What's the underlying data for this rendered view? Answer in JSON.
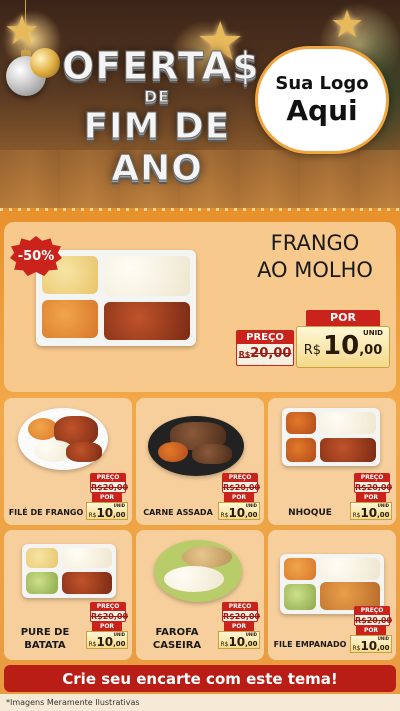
{
  "header": {
    "title_line1": "OFERTA$",
    "title_line2": "DE",
    "title_line3": "FIM DE ANO",
    "logo_line1": "Sua Logo",
    "logo_line2": "Aqui"
  },
  "featured": {
    "badge": "-50%",
    "name_line1": "FRANGO",
    "name_line2": "AO MOLHO",
    "preco_label": "PREÇO",
    "old_currency": "R$",
    "old_price": "20,00",
    "por_label": "POR",
    "currency": "R$",
    "price_int": "10",
    "price_dec": ",00",
    "unit": "UNID"
  },
  "products": [
    {
      "name_line1": "FILÉ DE FRANGO",
      "name_line2": "",
      "preco_label": "PREÇO",
      "old_price": "R$20,00",
      "por_label": "POR",
      "currency": "R$",
      "price_int": "10",
      "price_dec": ",00",
      "unit": "UNID"
    },
    {
      "name_line1": "CARNE ASSADA",
      "name_line2": "",
      "preco_label": "PREÇO",
      "old_price": "R$20,00",
      "por_label": "POR",
      "currency": "R$",
      "price_int": "10",
      "price_dec": ",00",
      "unit": "UNID"
    },
    {
      "name_line1": "NHOQUE",
      "name_line2": "",
      "preco_label": "PREÇO",
      "old_price": "R$20,00",
      "por_label": "POR",
      "currency": "R$",
      "price_int": "10",
      "price_dec": ",00",
      "unit": "UNID"
    },
    {
      "name_line1": "PURE DE",
      "name_line2": "BATATA",
      "preco_label": "PREÇO",
      "old_price": "R$20,00",
      "por_label": "POR",
      "currency": "R$",
      "price_int": "10",
      "price_dec": ",00",
      "unit": "UNID"
    },
    {
      "name_line1": "FAROFA",
      "name_line2": "CASEIRA",
      "preco_label": "PREÇO",
      "old_price": "R$20,00",
      "por_label": "POR",
      "currency": "R$",
      "price_int": "10",
      "price_dec": ",00",
      "unit": "UNID"
    },
    {
      "name_line1": "FILE EMPANADO",
      "name_line2": "",
      "preco_label": "PREÇO",
      "old_price": "R$20,00",
      "por_label": "POR",
      "currency": "R$",
      "price_int": "10",
      "price_dec": ",00",
      "unit": "UNID"
    }
  ],
  "cta": {
    "label": "Crie seu encarte com este tema!"
  },
  "footer": {
    "note": "*Imagens Meramente Ilustrativas"
  },
  "colors": {
    "accent_red": "#c9231c",
    "orange_bg": "#f0a640",
    "card_bg": "#f7cf9c",
    "header_brown": "#3b2418"
  }
}
